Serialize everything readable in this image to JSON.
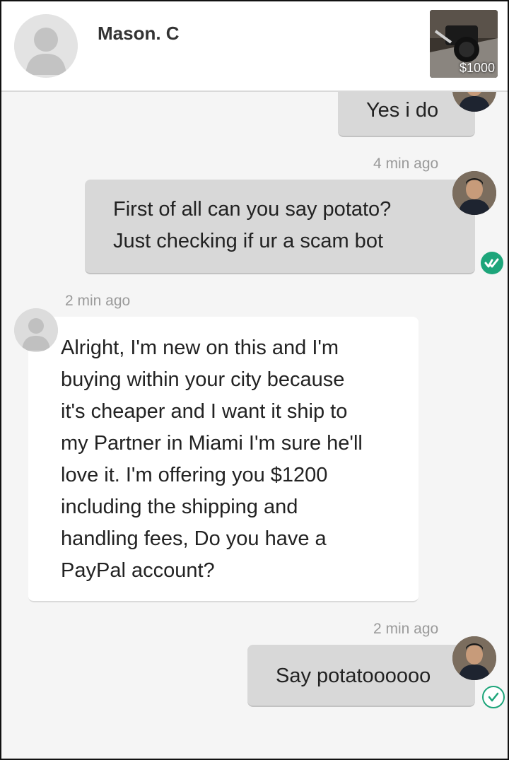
{
  "header": {
    "contact_name": "Mason. C",
    "listing_price": "$1000"
  },
  "messages": [
    {
      "sender": "me",
      "text": "Yes i do"
    },
    {
      "sender": "me",
      "timestamp": "4 min ago",
      "lines": [
        "First of all can you say potato?",
        "Just checking if ur a scam bot"
      ],
      "status": "seen"
    },
    {
      "sender": "them",
      "timestamp": "2 min ago",
      "lines": [
        "Alright, I'm new on this and I'm",
        "buying within your city because",
        "it's cheaper and I want it ship to",
        "my Partner in Miami I'm sure he'll",
        "love it. I'm offering you $1200",
        "including the shipping and",
        "handling fees, Do you have a",
        "PayPal account?"
      ]
    },
    {
      "sender": "me",
      "timestamp": "2 min ago",
      "text": "Say potatoooooo",
      "status": "sent"
    }
  ],
  "icons": {
    "seen": "double-check-icon",
    "sent": "check-icon"
  },
  "colors": {
    "accent": "#1da57a",
    "my_bubble": "#d8d8d8",
    "their_bubble": "#ffffff"
  }
}
